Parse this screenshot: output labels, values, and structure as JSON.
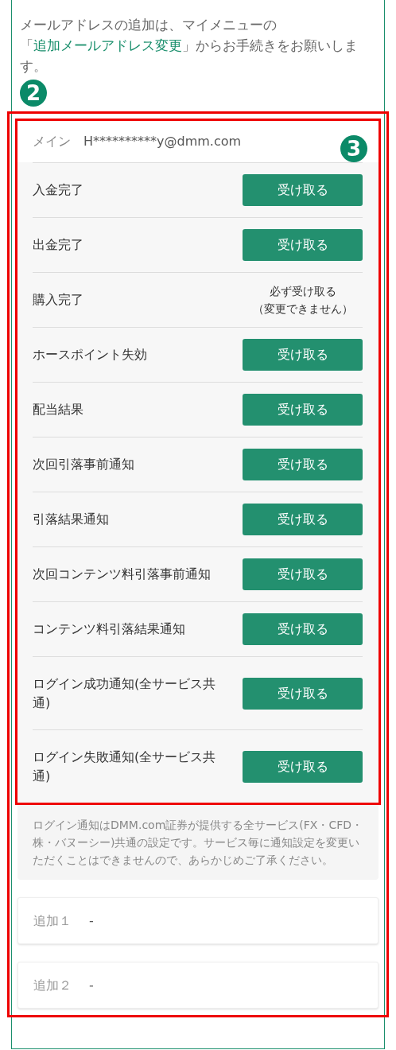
{
  "intro": {
    "before": "メールアドレスの追加は、マイメニューの「",
    "link": "追加メールアドレス変更",
    "after": "」からお手続きをお願いします。"
  },
  "markers": [
    {
      "label": "2"
    },
    {
      "label": "3"
    }
  ],
  "main": {
    "label": "メイン",
    "value": "H**********y@dmm.com"
  },
  "rows": [
    {
      "label": "入金完了",
      "kind": "button",
      "button": "受け取る"
    },
    {
      "label": "出金完了",
      "kind": "button",
      "button": "受け取る"
    },
    {
      "label": "購入完了",
      "kind": "fixed",
      "note_lines": [
        "必ず受け取る",
        "（変更できません）"
      ]
    },
    {
      "label": "ホースポイント失効",
      "kind": "button",
      "button": "受け取る"
    },
    {
      "label": "配当結果",
      "kind": "button",
      "button": "受け取る"
    },
    {
      "label": "次回引落事前通知",
      "kind": "button",
      "button": "受け取る"
    },
    {
      "label": "引落結果通知",
      "kind": "button",
      "button": "受け取る"
    },
    {
      "label": "次回コンテンツ料引落事前通知",
      "kind": "button",
      "button": "受け取る"
    },
    {
      "label": "コンテンツ料引落結果通知",
      "kind": "button",
      "button": "受け取る"
    },
    {
      "label": "ログイン成功通知(全サービス共通)",
      "kind": "button",
      "button": "受け取る"
    },
    {
      "label": "ログイン失敗通知(全サービス共通)",
      "kind": "button",
      "button": "受け取る"
    }
  ],
  "note": "ログイン通知はDMM.com証券が提供する全サービス(FX・CFD・株・バヌーシー)共通の設定です。サービス毎に通知設定を変更いただくことはできませんので、あらかじめご了承ください。",
  "additional": [
    {
      "label": "追加１",
      "value": "-"
    },
    {
      "label": "追加２",
      "value": "-"
    }
  ]
}
